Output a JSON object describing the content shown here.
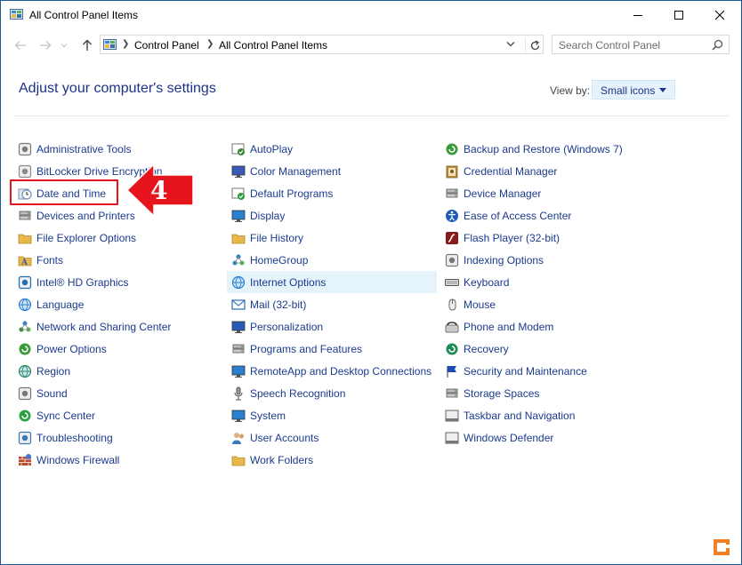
{
  "window": {
    "title": "All Control Panel Items",
    "minimize_icon": "minimize-icon",
    "maximize_icon": "maximize-icon",
    "close_icon": "close-icon"
  },
  "address": {
    "crumbs": [
      "Control Panel",
      "All Control Panel Items"
    ],
    "search_placeholder": "Search Control Panel"
  },
  "header": {
    "title": "Adjust your computer's settings",
    "view_by_label": "View by:",
    "view_by_value": "Small icons"
  },
  "annotation": {
    "step_number": "4",
    "color": "#e5141d"
  },
  "columns": [
    [
      {
        "label": "Administrative Tools",
        "icon": "tools-icon",
        "color": "#7a7a7a"
      },
      {
        "label": "BitLocker Drive Encryption",
        "icon": "bitlocker-icon",
        "color": "#8a8a8a"
      },
      {
        "label": "Date and Time",
        "icon": "clock-icon",
        "color": "#6f8fb8"
      },
      {
        "label": "Devices and Printers",
        "icon": "printer-icon",
        "color": "#555"
      },
      {
        "label": "File Explorer Options",
        "icon": "folder-options-icon",
        "color": "#e8b84a"
      },
      {
        "label": "Fonts",
        "icon": "fonts-icon",
        "color": "#e8b84a"
      },
      {
        "label": "Intel® HD Graphics",
        "icon": "intel-icon",
        "color": "#1e6fb8"
      },
      {
        "label": "Language",
        "icon": "language-icon",
        "color": "#2a7fd0"
      },
      {
        "label": "Network and Sharing Center",
        "icon": "network-icon",
        "color": "#3a8a3a"
      },
      {
        "label": "Power Options",
        "icon": "power-icon",
        "color": "#3a9a3a"
      },
      {
        "label": "Region",
        "icon": "region-icon",
        "color": "#2a8a5a"
      },
      {
        "label": "Sound",
        "icon": "sound-icon",
        "color": "#777"
      },
      {
        "label": "Sync Center",
        "icon": "sync-icon",
        "color": "#2aa040"
      },
      {
        "label": "Troubleshooting",
        "icon": "troubleshooting-icon",
        "color": "#3a7ab8"
      },
      {
        "label": "Windows Firewall",
        "icon": "firewall-icon",
        "color": "#b84a2a"
      }
    ],
    [
      {
        "label": "AutoPlay",
        "icon": "autoplay-icon",
        "color": "#3a8a3a"
      },
      {
        "label": "Color Management",
        "icon": "color-management-icon",
        "color": "#3a5ab8"
      },
      {
        "label": "Default Programs",
        "icon": "default-programs-icon",
        "color": "#2a9a3a"
      },
      {
        "label": "Display",
        "icon": "display-icon",
        "color": "#2a7fd0"
      },
      {
        "label": "File History",
        "icon": "file-history-icon",
        "color": "#e8b84a"
      },
      {
        "label": "HomeGroup",
        "icon": "homegroup-icon",
        "color": "#1e8ab8"
      },
      {
        "label": "Internet Options",
        "icon": "internet-options-icon",
        "color": "#2a7fd0"
      },
      {
        "label": "Mail (32-bit)",
        "icon": "mail-icon",
        "color": "#2a6ab8"
      },
      {
        "label": "Personalization",
        "icon": "personalization-icon",
        "color": "#2a5ab8"
      },
      {
        "label": "Programs and Features",
        "icon": "programs-icon",
        "color": "#555"
      },
      {
        "label": "RemoteApp and Desktop Connections",
        "icon": "remoteapp-icon",
        "color": "#2a7fd0"
      },
      {
        "label": "Speech Recognition",
        "icon": "microphone-icon",
        "color": "#777"
      },
      {
        "label": "System",
        "icon": "system-icon",
        "color": "#2a7fd0"
      },
      {
        "label": "User Accounts",
        "icon": "user-accounts-icon",
        "color": "#b87a3a"
      },
      {
        "label": "Work Folders",
        "icon": "work-folders-icon",
        "color": "#e8b84a"
      }
    ],
    [
      {
        "label": "Backup and Restore (Windows 7)",
        "icon": "backup-icon",
        "color": "#3a9a3a"
      },
      {
        "label": "Credential Manager",
        "icon": "credential-icon",
        "color": "#b88a3a"
      },
      {
        "label": "Device Manager",
        "icon": "device-manager-icon",
        "color": "#555"
      },
      {
        "label": "Ease of Access Center",
        "icon": "ease-of-access-icon",
        "color": "#1e5ab8"
      },
      {
        "label": "Flash Player (32-bit)",
        "icon": "flash-icon",
        "color": "#8a1a1a"
      },
      {
        "label": "Indexing Options",
        "icon": "indexing-icon",
        "color": "#777"
      },
      {
        "label": "Keyboard",
        "icon": "keyboard-icon",
        "color": "#555"
      },
      {
        "label": "Mouse",
        "icon": "mouse-icon",
        "color": "#777"
      },
      {
        "label": "Phone and Modem",
        "icon": "phone-icon",
        "color": "#555"
      },
      {
        "label": "Recovery",
        "icon": "recovery-icon",
        "color": "#1e8a5a"
      },
      {
        "label": "Security and Maintenance",
        "icon": "flag-icon",
        "color": "#1e4ab8"
      },
      {
        "label": "Storage Spaces",
        "icon": "storage-icon",
        "color": "#777"
      },
      {
        "label": "Taskbar and Navigation",
        "icon": "taskbar-icon",
        "color": "#555"
      },
      {
        "label": "Windows Defender",
        "icon": "defender-icon",
        "color": "#777"
      }
    ]
  ]
}
